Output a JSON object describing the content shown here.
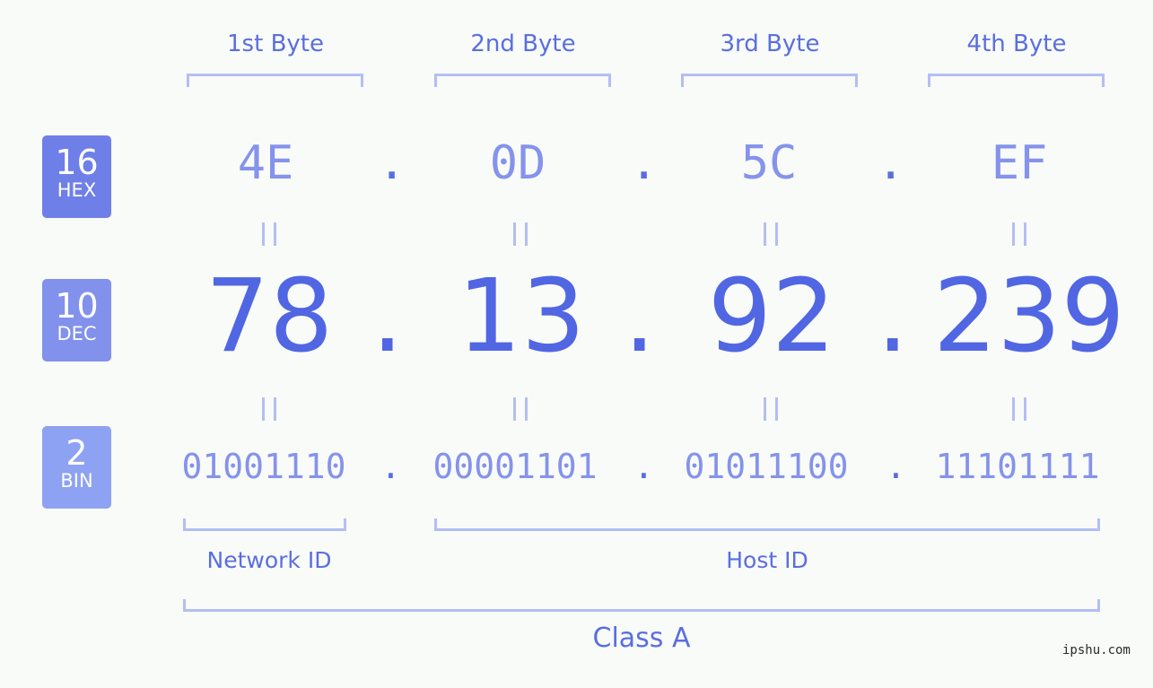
{
  "byte_headers": [
    "1st Byte",
    "2nd Byte",
    "3rd Byte",
    "4th Byte"
  ],
  "badges": {
    "hex": {
      "number": "16",
      "label": "HEX",
      "color": "#6f7fe8"
    },
    "dec": {
      "number": "10",
      "label": "DEC",
      "color": "#8191ec"
    },
    "bin": {
      "number": "2",
      "label": "BIN",
      "color": "#8da2f3"
    }
  },
  "hex": {
    "octets": [
      "4E",
      "0D",
      "5C",
      "EF"
    ],
    "separator": "."
  },
  "dec": {
    "octets": [
      "78",
      "13",
      "92",
      "239"
    ],
    "separator": "."
  },
  "bin": {
    "octets": [
      "01001110",
      "00001101",
      "01011100",
      "11101111"
    ],
    "separator": "."
  },
  "network_id_label": "Network ID",
  "host_id_label": "Host ID",
  "class_label": "Class A",
  "watermark": "ipshu.com",
  "colors": {
    "accent": "#5166e3",
    "light_accent": "#8593ea",
    "bracket": "#b4bef3",
    "background": "#f8fbf8"
  }
}
